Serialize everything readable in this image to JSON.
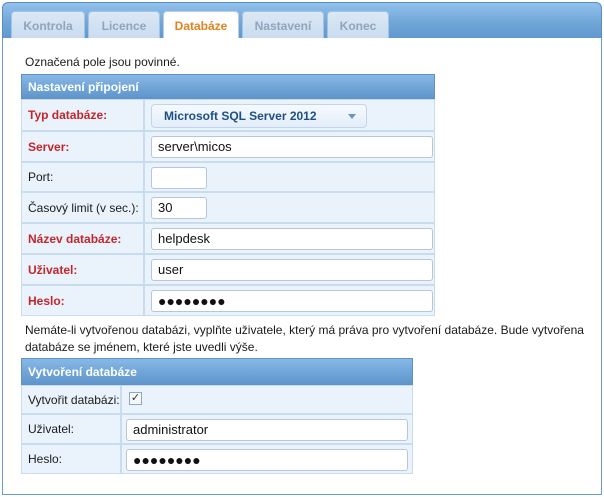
{
  "tabs": [
    {
      "label": "Kontrola",
      "active": false
    },
    {
      "label": "Licence",
      "active": false
    },
    {
      "label": "Databáze",
      "active": true
    },
    {
      "label": "Nastavení",
      "active": false
    },
    {
      "label": "Konec",
      "active": false
    }
  ],
  "required_note": "Označená pole jsou povinné.",
  "connection": {
    "header": "Nastavení připojení",
    "fields": [
      {
        "label": "Typ databáze:",
        "required": true,
        "value": "Microsoft SQL Server 2012"
      },
      {
        "label": "Server:",
        "required": true,
        "value": "server\\micos"
      },
      {
        "label": "Port:",
        "required": false,
        "value": ""
      },
      {
        "label": "Časový limit (v sec.):",
        "required": false,
        "value": "30"
      },
      {
        "label": "Název databáze:",
        "required": true,
        "value": "helpdesk"
      },
      {
        "label": "Uživatel:",
        "required": true,
        "value": "user"
      },
      {
        "label": "Heslo:",
        "required": true,
        "value": "●●●●●●●●"
      }
    ]
  },
  "create_note_line1": "Nemáte-li vytvořenou databázi, vyplňte uživatele, který má práva pro vytvoření databáze. Bude vytvořena",
  "create_note_line2": "databáze se jménem, které jste uvedli výše.",
  "creation": {
    "header": "Vytvoření databáze",
    "fields": [
      {
        "label": "Vytvořit databázi:",
        "checked": true,
        "check_mark": "✓"
      },
      {
        "label": "Uživatel:",
        "value": "administrator"
      },
      {
        "label": "Heslo:",
        "value": "●●●●●●●●"
      }
    ]
  },
  "colors": {
    "accent": "#e4831e",
    "header": "#6ea3d6",
    "required": "#c4262c"
  }
}
